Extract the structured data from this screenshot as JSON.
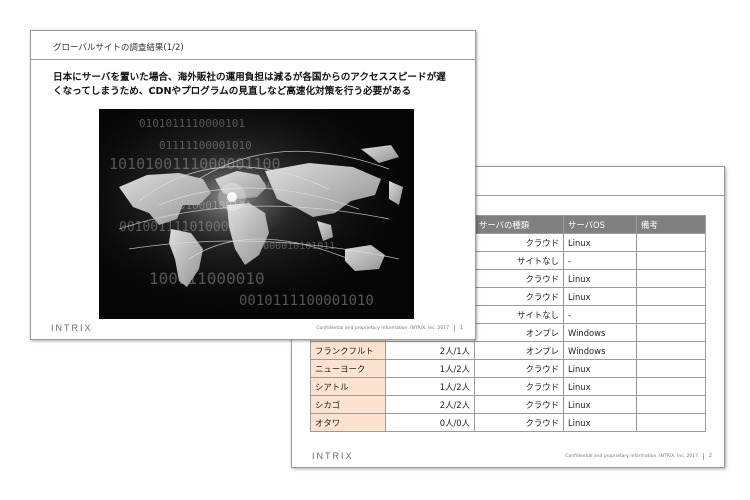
{
  "slide1": {
    "title": "グローバルサイトの調査結果(1/2)",
    "headline_line1": "日本にサーバを置いた場合、海外販社の運用負担は減るが各国からのアクセススピードが遅",
    "headline_line2": "くなってしまうため、CDNやプログラムの見直しなど高速化対策を行う必要がある",
    "footer_logo": "INTRIX",
    "confidential": "Confidential and proprietary information. INTRIX, Inc. 2017",
    "page_number": "1"
  },
  "slide2": {
    "table": {
      "headers": [
        "",
        "",
        "サーバの種類",
        "サーバOS",
        "備考"
      ],
      "rows": [
        {
          "city": "",
          "staff": "",
          "type": "クラウド",
          "os": "Linux",
          "note": ""
        },
        {
          "city": "",
          "staff": "",
          "type": "サイトなし",
          "os": "-",
          "note": ""
        },
        {
          "city": "",
          "staff": "",
          "type": "クラウド",
          "os": "Linux",
          "note": ""
        },
        {
          "city": "",
          "staff": "",
          "type": "クラウド",
          "os": "Linux",
          "note": ""
        },
        {
          "city": "",
          "staff": "",
          "type": "サイトなし",
          "os": "-",
          "note": ""
        },
        {
          "city": "",
          "staff": "",
          "type": "オンプレ",
          "os": "Windows",
          "note": ""
        },
        {
          "city": "フランクフルト",
          "staff": "2人/1人",
          "type": "オンプレ",
          "os": "Windows",
          "note": ""
        },
        {
          "city": "ニューヨーク",
          "staff": "1人/2人",
          "type": "クラウド",
          "os": "Linux",
          "note": ""
        },
        {
          "city": "シアトル",
          "staff": "1人/2人",
          "type": "クラウド",
          "os": "Linux",
          "note": ""
        },
        {
          "city": "シカゴ",
          "staff": "2人/2人",
          "type": "クラウド",
          "os": "Linux",
          "note": ""
        },
        {
          "city": "オタワ",
          "staff": "0人/0人",
          "type": "クラウド",
          "os": "Linux",
          "note": ""
        }
      ]
    },
    "footer_logo": "INTRIX",
    "confidential": "Confidential and proprietary information. INTRIX, Inc. 2017",
    "page_number": "2"
  },
  "photo_binary_rows": [
    "0101011110000101",
    "01111100001010",
    "1010100111000001100",
    "0110100001011110",
    "10010101000100101",
    "0010011110100010",
    "1010000010101011",
    "100111000010",
    "0010111100001010"
  ],
  "colors": {
    "table_header_bg": "#808080",
    "city_cell_bg": "#fde3cf",
    "title_rule": "#a8a58c",
    "accent": "#b5ad74"
  }
}
